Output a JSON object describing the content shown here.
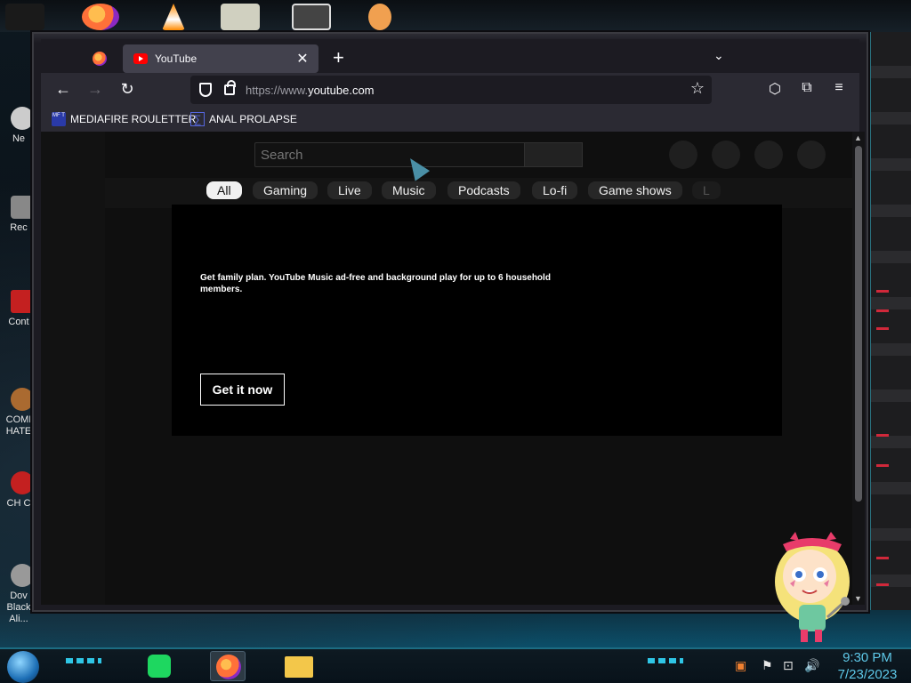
{
  "browser": {
    "tab_title": "YouTube",
    "tab_close": "✕",
    "new_tab": "+",
    "tab_list": "⌄",
    "nav": {
      "back": "←",
      "forward": "→",
      "reload": "↻"
    },
    "url_prefix": "https://www.",
    "url_domain": "youtube.com",
    "bookmark_star": "☆",
    "right_icons": {
      "pocket": "⬡",
      "extensions": "⧉",
      "menu": "≡"
    },
    "bookmarks": [
      {
        "icon": "MF T",
        "label": "MEDIAFIRE ROULETTER"
      },
      {
        "icon": "∑",
        "label": "ANAL PROLAPSE"
      }
    ]
  },
  "youtube": {
    "search_placeholder": "Search",
    "chips": [
      {
        "label": "All",
        "active": true
      },
      {
        "label": "Gaming",
        "active": false
      },
      {
        "label": "Live",
        "active": false
      },
      {
        "label": "Music",
        "active": false
      },
      {
        "label": "Podcasts",
        "active": false
      },
      {
        "label": "Lo-fi",
        "active": false
      },
      {
        "label": "Game shows",
        "active": false
      },
      {
        "label": "L",
        "active": false
      }
    ],
    "banner": {
      "text": "Get family plan. YouTube Music ad-free and background play for up to 6 household members.",
      "button": "Get it now"
    }
  },
  "desktop": {
    "icons": [
      {
        "label": "Ne"
      },
      {
        "label": "Rec"
      },
      {
        "label": "Cont"
      },
      {
        "label": "COMI HATE"
      },
      {
        "label": "CH C"
      },
      {
        "label": "Dov Black Ali..."
      }
    ]
  },
  "taskbar": {
    "time": "9:30 PM",
    "date": "7/23/2023"
  },
  "colors": {
    "accent": "#5ec8e8",
    "yt_red": "#ff0000",
    "page_bg": "#0f0f0f"
  }
}
